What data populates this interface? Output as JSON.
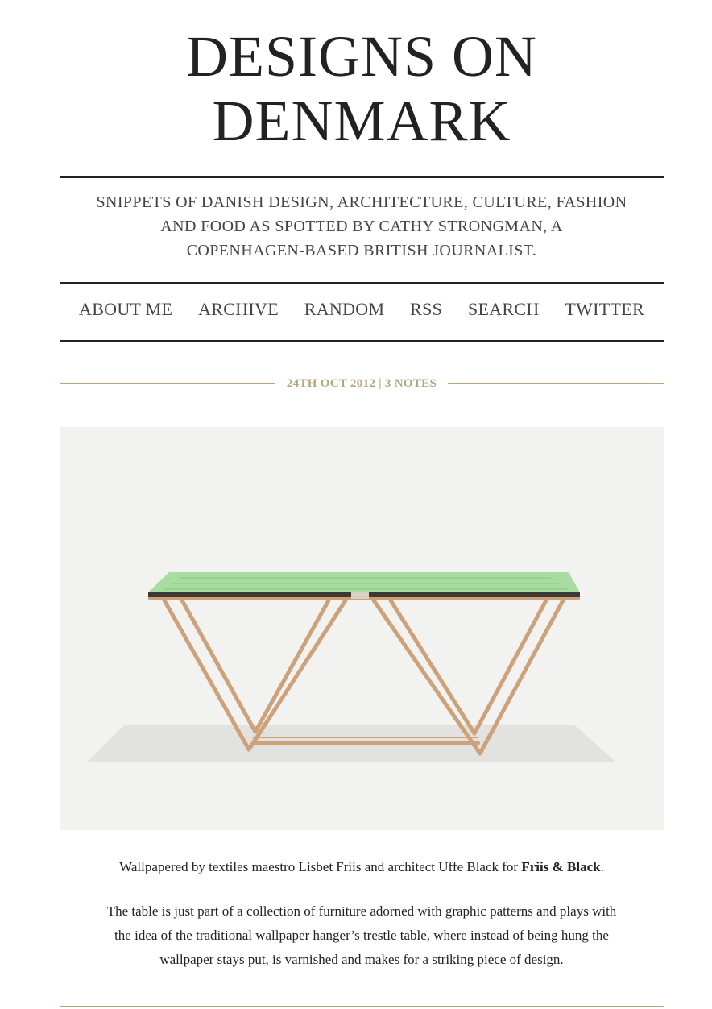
{
  "header": {
    "title_line1": "DESIGNS ON",
    "title_line2": "DENMARK",
    "description_line1": "SNIPPETS OF DANISH DESIGN, ARCHITECTURE, CULTURE, FASHION",
    "description_line2": "AND FOOD AS SPOTTED BY CATHY STRONGMAN, A",
    "description_line3": "COPENHAGEN-BASED BRITISH JOURNALIST."
  },
  "nav": {
    "items": [
      "ABOUT ME",
      "ARCHIVE",
      "RANDOM",
      "RSS",
      "SEARCH",
      "TWITTER"
    ]
  },
  "post": {
    "date": "24TH OCT 2012",
    "separator": "|",
    "notes": "3 NOTES",
    "image_icon": "table-photo",
    "caption_prefix": "Wallpapered by textiles maestro Lisbet Friis and architect Uffe Black for ",
    "caption_link": "Friis & Black",
    "caption_suffix": ".",
    "body_line1": "The table is just part of a collection of furniture adorned with graphic patterns and plays with",
    "body_line2": "the idea of the traditional wallpaper hanger’s trestle table, where instead of being hung the",
    "body_line3": "wallpaper stays put, is varnished and makes for a striking piece of design."
  },
  "colors": {
    "text": "#222222",
    "gold": "#b5a67c",
    "photo_bg": "#f2f2f0",
    "table_top": "#a8dca0",
    "wood": "#cda27a"
  }
}
